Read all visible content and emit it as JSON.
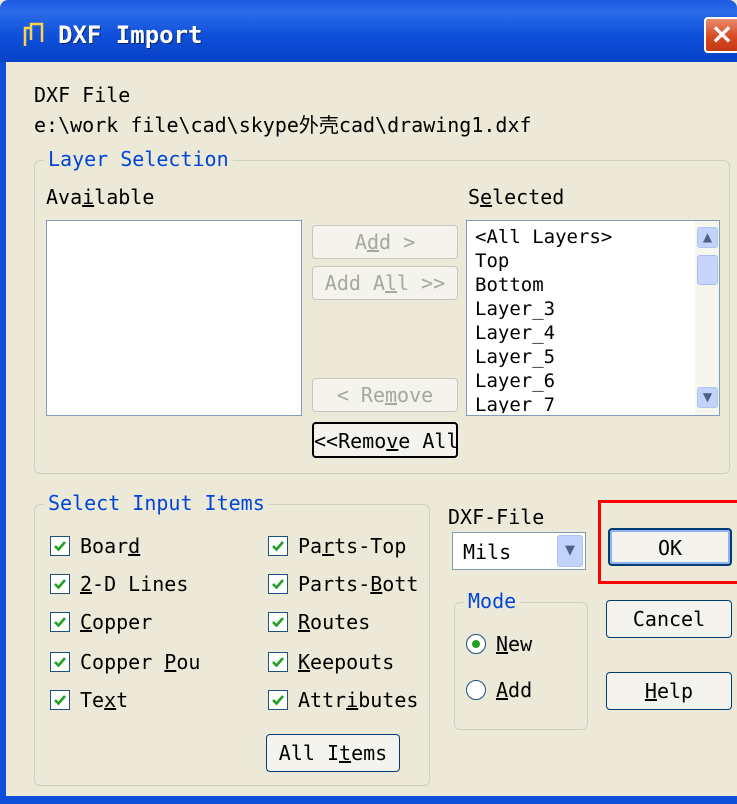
{
  "window": {
    "title": "DXF Import",
    "close_label": "×"
  },
  "file": {
    "label": "DXF File",
    "path": "e:\\work file\\cad\\skype外壳cad\\drawing1.dxf"
  },
  "layer_selection": {
    "legend": "Layer Selection",
    "available_label": "Available",
    "selected_label": "Selected",
    "available_items": [],
    "selected_items": [
      "<All Layers>",
      "Top",
      "Bottom",
      "Layer_3",
      "Layer_4",
      "Layer_5",
      "Layer_6",
      "Layer_7"
    ],
    "buttons": {
      "add": "Add >",
      "add_all": "Add All >>",
      "remove": "< Remove",
      "remove_all": "<<Remove All"
    }
  },
  "input_items": {
    "legend": "Select Input Items",
    "items": [
      {
        "label": "Board",
        "checked": true
      },
      {
        "label": "2-D Lines",
        "checked": true
      },
      {
        "label": "Copper",
        "checked": true
      },
      {
        "label": "Copper Pou",
        "checked": true
      },
      {
        "label": "Text",
        "checked": true
      },
      {
        "label": "Parts-Top",
        "checked": true
      },
      {
        "label": "Parts-Bott",
        "checked": true
      },
      {
        "label": "Routes",
        "checked": true
      },
      {
        "label": "Keepouts",
        "checked": true
      },
      {
        "label": "Attributes",
        "checked": true
      }
    ],
    "all_items_label": "All Items"
  },
  "units": {
    "label": "DXF-File",
    "value": "Mils"
  },
  "mode": {
    "legend": "Mode",
    "options": [
      {
        "label": "New",
        "selected": true
      },
      {
        "label": "Add",
        "selected": false
      }
    ]
  },
  "actions": {
    "ok": "OK",
    "cancel": "Cancel",
    "help": "Help"
  },
  "colors": {
    "titlebar": "#0e4ed9",
    "group_legend": "#0046d5",
    "highlight": "#ff0000",
    "check": "#21a121"
  }
}
